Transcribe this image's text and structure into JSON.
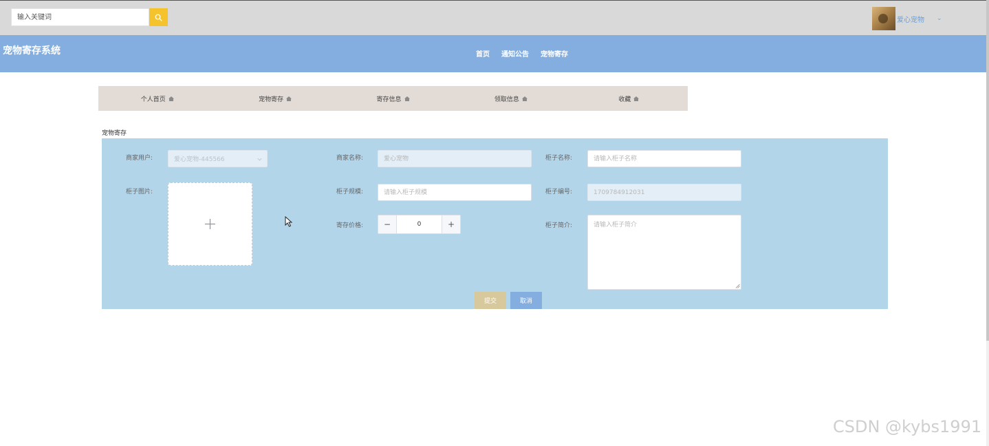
{
  "topbar": {
    "search": {
      "placeholder": "输入关键词",
      "value": ""
    },
    "user": {
      "name": "爱心宠物"
    }
  },
  "navbar": {
    "title": "宠物寄存系统",
    "links": [
      {
        "label": "首页"
      },
      {
        "label": "通知公告"
      },
      {
        "label": "宠物寄存"
      }
    ]
  },
  "menu": {
    "tabs": [
      {
        "label": "个人首页"
      },
      {
        "label": "宠物寄存"
      },
      {
        "label": "寄存信息"
      },
      {
        "label": "领取信息"
      },
      {
        "label": "收藏"
      }
    ]
  },
  "section": {
    "title": "宠物寄存"
  },
  "form": {
    "merchant_user": {
      "label": "商家用户:",
      "value": "爱心宠物-445566"
    },
    "merchant_name": {
      "label": "商家名称:",
      "placeholder": "爱心宠物"
    },
    "cabinet_name": {
      "label": "柜子名称:",
      "placeholder": "请输入柜子名称"
    },
    "cabinet_image": {
      "label": "柜子图片:"
    },
    "cabinet_spec": {
      "label": "柜子规模:",
      "placeholder": "请输入柜子规模"
    },
    "cabinet_number": {
      "label": "柜子编号:",
      "placeholder": "1709784912031"
    },
    "price": {
      "label": "寄存价格:",
      "value": "0"
    },
    "cabinet_intro": {
      "label": "柜子简介:",
      "placeholder": "请输入柜子简介"
    },
    "submit_label": "提交",
    "cancel_label": "取消"
  },
  "watermark": "CSDN @kybs1991",
  "colors": {
    "topbar_bg": "#d9d9d9",
    "navbar_bg": "#84aee0",
    "search_btn": "#f5c32c",
    "menu_bg": "#e3dcd6",
    "form_bg": "#b3d5ea",
    "submit_btn": "#d8c99c",
    "cancel_btn": "#84aee0"
  },
  "icons": {
    "search_button": "search-icon",
    "user_menu": "chevron-down-icon",
    "menu_tabs": "home-icon",
    "select": "chevron-down-icon",
    "uploader": "plus-icon"
  }
}
